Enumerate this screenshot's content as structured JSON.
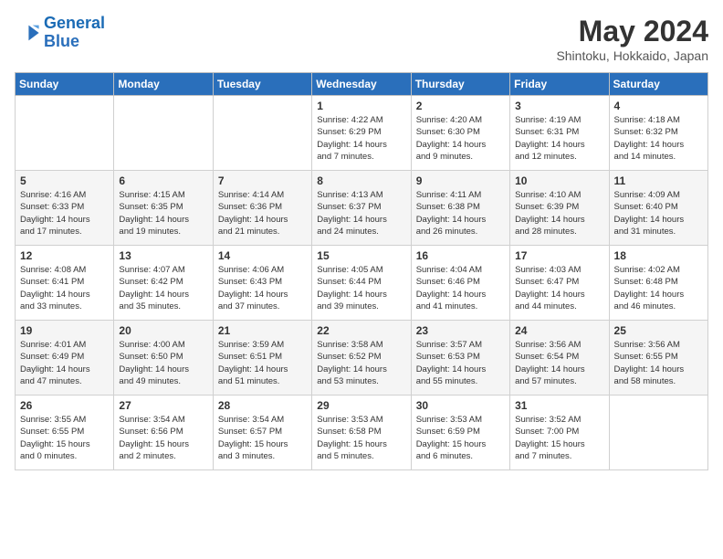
{
  "logo": {
    "line1": "General",
    "line2": "Blue"
  },
  "title": "May 2024",
  "subtitle": "Shintoku, Hokkaido, Japan",
  "days_of_week": [
    "Sunday",
    "Monday",
    "Tuesday",
    "Wednesday",
    "Thursday",
    "Friday",
    "Saturday"
  ],
  "weeks": [
    [
      {
        "day": "",
        "info": ""
      },
      {
        "day": "",
        "info": ""
      },
      {
        "day": "",
        "info": ""
      },
      {
        "day": "1",
        "info": "Sunrise: 4:22 AM\nSunset: 6:29 PM\nDaylight: 14 hours\nand 7 minutes."
      },
      {
        "day": "2",
        "info": "Sunrise: 4:20 AM\nSunset: 6:30 PM\nDaylight: 14 hours\nand 9 minutes."
      },
      {
        "day": "3",
        "info": "Sunrise: 4:19 AM\nSunset: 6:31 PM\nDaylight: 14 hours\nand 12 minutes."
      },
      {
        "day": "4",
        "info": "Sunrise: 4:18 AM\nSunset: 6:32 PM\nDaylight: 14 hours\nand 14 minutes."
      }
    ],
    [
      {
        "day": "5",
        "info": "Sunrise: 4:16 AM\nSunset: 6:33 PM\nDaylight: 14 hours\nand 17 minutes."
      },
      {
        "day": "6",
        "info": "Sunrise: 4:15 AM\nSunset: 6:35 PM\nDaylight: 14 hours\nand 19 minutes."
      },
      {
        "day": "7",
        "info": "Sunrise: 4:14 AM\nSunset: 6:36 PM\nDaylight: 14 hours\nand 21 minutes."
      },
      {
        "day": "8",
        "info": "Sunrise: 4:13 AM\nSunset: 6:37 PM\nDaylight: 14 hours\nand 24 minutes."
      },
      {
        "day": "9",
        "info": "Sunrise: 4:11 AM\nSunset: 6:38 PM\nDaylight: 14 hours\nand 26 minutes."
      },
      {
        "day": "10",
        "info": "Sunrise: 4:10 AM\nSunset: 6:39 PM\nDaylight: 14 hours\nand 28 minutes."
      },
      {
        "day": "11",
        "info": "Sunrise: 4:09 AM\nSunset: 6:40 PM\nDaylight: 14 hours\nand 31 minutes."
      }
    ],
    [
      {
        "day": "12",
        "info": "Sunrise: 4:08 AM\nSunset: 6:41 PM\nDaylight: 14 hours\nand 33 minutes."
      },
      {
        "day": "13",
        "info": "Sunrise: 4:07 AM\nSunset: 6:42 PM\nDaylight: 14 hours\nand 35 minutes."
      },
      {
        "day": "14",
        "info": "Sunrise: 4:06 AM\nSunset: 6:43 PM\nDaylight: 14 hours\nand 37 minutes."
      },
      {
        "day": "15",
        "info": "Sunrise: 4:05 AM\nSunset: 6:44 PM\nDaylight: 14 hours\nand 39 minutes."
      },
      {
        "day": "16",
        "info": "Sunrise: 4:04 AM\nSunset: 6:46 PM\nDaylight: 14 hours\nand 41 minutes."
      },
      {
        "day": "17",
        "info": "Sunrise: 4:03 AM\nSunset: 6:47 PM\nDaylight: 14 hours\nand 44 minutes."
      },
      {
        "day": "18",
        "info": "Sunrise: 4:02 AM\nSunset: 6:48 PM\nDaylight: 14 hours\nand 46 minutes."
      }
    ],
    [
      {
        "day": "19",
        "info": "Sunrise: 4:01 AM\nSunset: 6:49 PM\nDaylight: 14 hours\nand 47 minutes."
      },
      {
        "day": "20",
        "info": "Sunrise: 4:00 AM\nSunset: 6:50 PM\nDaylight: 14 hours\nand 49 minutes."
      },
      {
        "day": "21",
        "info": "Sunrise: 3:59 AM\nSunset: 6:51 PM\nDaylight: 14 hours\nand 51 minutes."
      },
      {
        "day": "22",
        "info": "Sunrise: 3:58 AM\nSunset: 6:52 PM\nDaylight: 14 hours\nand 53 minutes."
      },
      {
        "day": "23",
        "info": "Sunrise: 3:57 AM\nSunset: 6:53 PM\nDaylight: 14 hours\nand 55 minutes."
      },
      {
        "day": "24",
        "info": "Sunrise: 3:56 AM\nSunset: 6:54 PM\nDaylight: 14 hours\nand 57 minutes."
      },
      {
        "day": "25",
        "info": "Sunrise: 3:56 AM\nSunset: 6:55 PM\nDaylight: 14 hours\nand 58 minutes."
      }
    ],
    [
      {
        "day": "26",
        "info": "Sunrise: 3:55 AM\nSunset: 6:55 PM\nDaylight: 15 hours\nand 0 minutes."
      },
      {
        "day": "27",
        "info": "Sunrise: 3:54 AM\nSunset: 6:56 PM\nDaylight: 15 hours\nand 2 minutes."
      },
      {
        "day": "28",
        "info": "Sunrise: 3:54 AM\nSunset: 6:57 PM\nDaylight: 15 hours\nand 3 minutes."
      },
      {
        "day": "29",
        "info": "Sunrise: 3:53 AM\nSunset: 6:58 PM\nDaylight: 15 hours\nand 5 minutes."
      },
      {
        "day": "30",
        "info": "Sunrise: 3:53 AM\nSunset: 6:59 PM\nDaylight: 15 hours\nand 6 minutes."
      },
      {
        "day": "31",
        "info": "Sunrise: 3:52 AM\nSunset: 7:00 PM\nDaylight: 15 hours\nand 7 minutes."
      },
      {
        "day": "",
        "info": ""
      }
    ]
  ]
}
